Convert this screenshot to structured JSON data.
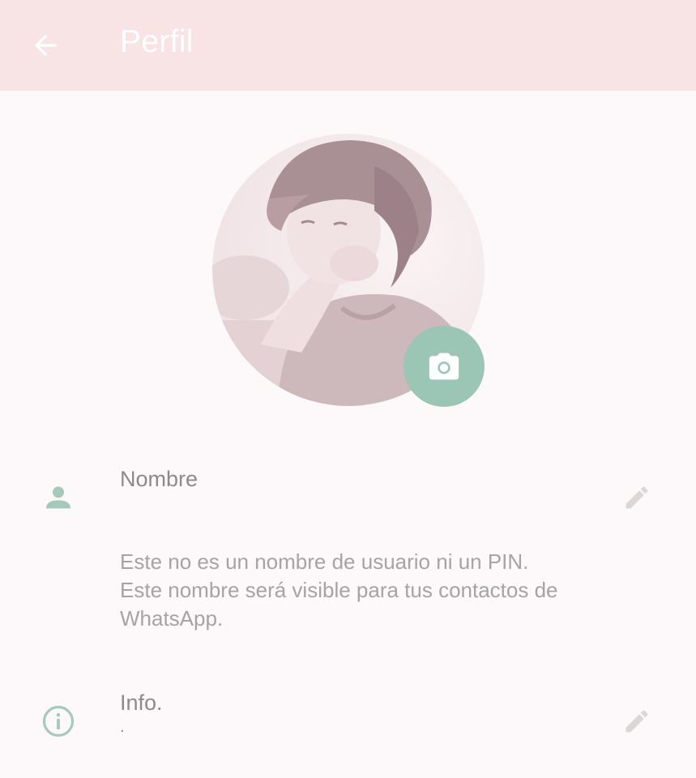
{
  "header": {
    "title": "Perfil",
    "back_icon": "arrow-left-icon",
    "background": "#f8e3e5"
  },
  "profile": {
    "photo_icon": "profile-photo",
    "camera_icon": "camera-icon",
    "accent_color": "#9bc6b6"
  },
  "name_section": {
    "icon": "person-icon",
    "label": "Nombre",
    "edit_icon": "pencil-icon",
    "help_lines": [
      "Este no es un nombre de usuario ni un PIN.",
      "Este nombre será visible para tus contactos de",
      "WhatsApp."
    ]
  },
  "info_section": {
    "icon": "info-icon",
    "label": "Info.",
    "value": ".",
    "edit_icon": "pencil-icon"
  }
}
